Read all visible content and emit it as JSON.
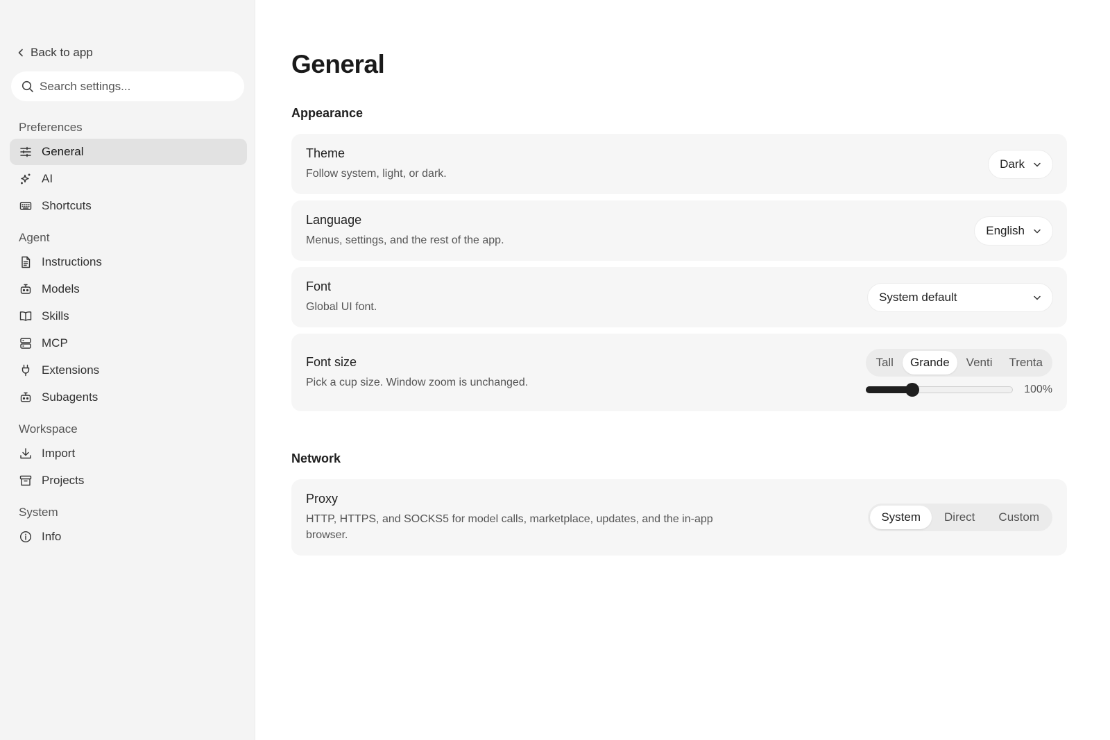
{
  "sidebar": {
    "back_label": "Back to app",
    "search_placeholder": "Search settings...",
    "sections": [
      {
        "title": "Preferences",
        "items": [
          {
            "label": "General",
            "icon": "sliders-icon",
            "active": true
          },
          {
            "label": "AI",
            "icon": "sparkles-icon"
          },
          {
            "label": "Shortcuts",
            "icon": "keyboard-icon"
          }
        ]
      },
      {
        "title": "Agent",
        "items": [
          {
            "label": "Instructions",
            "icon": "document-icon"
          },
          {
            "label": "Models",
            "icon": "robot-icon"
          },
          {
            "label": "Skills",
            "icon": "book-icon"
          },
          {
            "label": "MCP",
            "icon": "server-icon"
          },
          {
            "label": "Extensions",
            "icon": "plug-icon"
          },
          {
            "label": "Subagents",
            "icon": "robot-icon"
          }
        ]
      },
      {
        "title": "Workspace",
        "items": [
          {
            "label": "Import",
            "icon": "download-icon"
          },
          {
            "label": "Projects",
            "icon": "archive-icon"
          }
        ]
      },
      {
        "title": "System",
        "items": [
          {
            "label": "Info",
            "icon": "info-icon"
          }
        ]
      }
    ]
  },
  "main": {
    "title": "General",
    "appearance": {
      "title": "Appearance",
      "theme": {
        "title": "Theme",
        "desc": "Follow system, light, or dark.",
        "value": "Dark"
      },
      "language": {
        "title": "Language",
        "desc": "Menus, settings, and the rest of the app.",
        "value": "English"
      },
      "font": {
        "title": "Font",
        "desc": "Global UI font.",
        "value": "System default"
      },
      "font_size": {
        "title": "Font size",
        "desc": "Pick a cup size. Window zoom is unchanged.",
        "options": [
          "Tall",
          "Grande",
          "Venti",
          "Trenta"
        ],
        "selected": "Grande",
        "zoom_label": "100%",
        "slider_fraction": 0.31
      }
    },
    "network": {
      "title": "Network",
      "proxy": {
        "title": "Proxy",
        "desc_line1": "HTTP, HTTPS, and SOCKS5 for model calls, marketplace, updates, and the in-app",
        "desc_line2": "browser.",
        "options": [
          "System",
          "Direct",
          "Custom"
        ],
        "selected": "System"
      }
    }
  }
}
